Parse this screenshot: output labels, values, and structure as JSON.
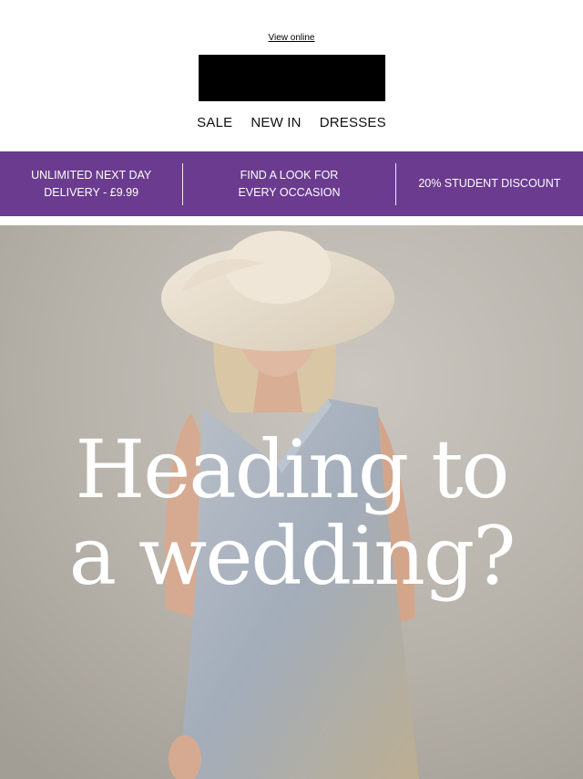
{
  "header": {
    "view_online": "View online",
    "logo_alt": "Logo",
    "nav": [
      {
        "label": "SALE"
      },
      {
        "label": "NEW IN"
      },
      {
        "label": "DRESSES"
      }
    ]
  },
  "promo": {
    "color": "#6a3b8f",
    "items": [
      {
        "line1": "UNLIMITED NEXT DAY",
        "line2": "DELIVERY - £9.99"
      },
      {
        "line1": "FIND A LOOK FOR",
        "line2": "EVERY OCCASION"
      },
      {
        "line1": "20% STUDENT DISCOUNT",
        "line2": ""
      }
    ]
  },
  "hero": {
    "headline_line1": "Heading to",
    "headline_line2": "a wedding?",
    "image_description_colors": {
      "background": "#b8b3ab",
      "hat": "#ece3d3",
      "dress": "#a9b1bd",
      "skin": "#d9b39b",
      "hair": "#d8c4a2"
    }
  }
}
